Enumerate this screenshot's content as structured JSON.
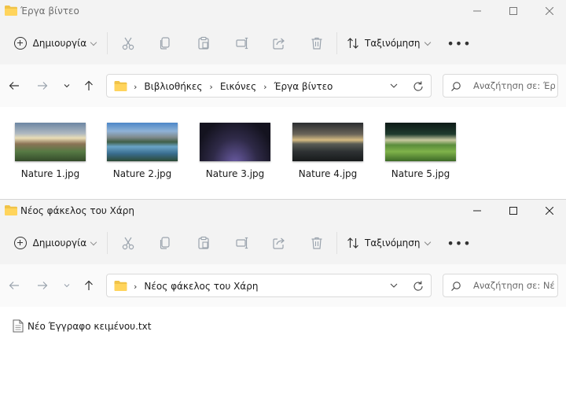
{
  "colors": {
    "folder": "#f0c348",
    "folder_dark": "#e3a929",
    "icon_gray": "#9aa3ad",
    "text": "#1b1b1b"
  },
  "window1": {
    "title": "Έργα βίντεο",
    "toolbar": {
      "new_label": "Δημιουργία",
      "sort_label": "Ταξινόμηση",
      "more_label": "•••"
    },
    "breadcrumb": [
      "Βιβλιοθήκες",
      "Εικόνες",
      "Έργα βίντεο"
    ],
    "search_placeholder": "Αναζήτηση σε: Έργα βίντεο",
    "files": [
      {
        "name": "Nature 1.jpg"
      },
      {
        "name": "Nature 2.jpg"
      },
      {
        "name": "Nature 3.jpg"
      },
      {
        "name": "Nature 4.jpg"
      },
      {
        "name": "Nature 5.jpg"
      }
    ]
  },
  "window2": {
    "title": "Νέος φάκελος του Χάρη",
    "toolbar": {
      "new_label": "Δημιουργία",
      "sort_label": "Ταξινόμηση",
      "more_label": "•••"
    },
    "breadcrumb": [
      "Νέος φάκελος του Χάρη"
    ],
    "search_placeholder": "Αναζήτηση σε: Νέος φάκελος του Χάρη",
    "files": [
      {
        "name": "Νέο Έγγραφο κειμένου.txt"
      }
    ]
  }
}
